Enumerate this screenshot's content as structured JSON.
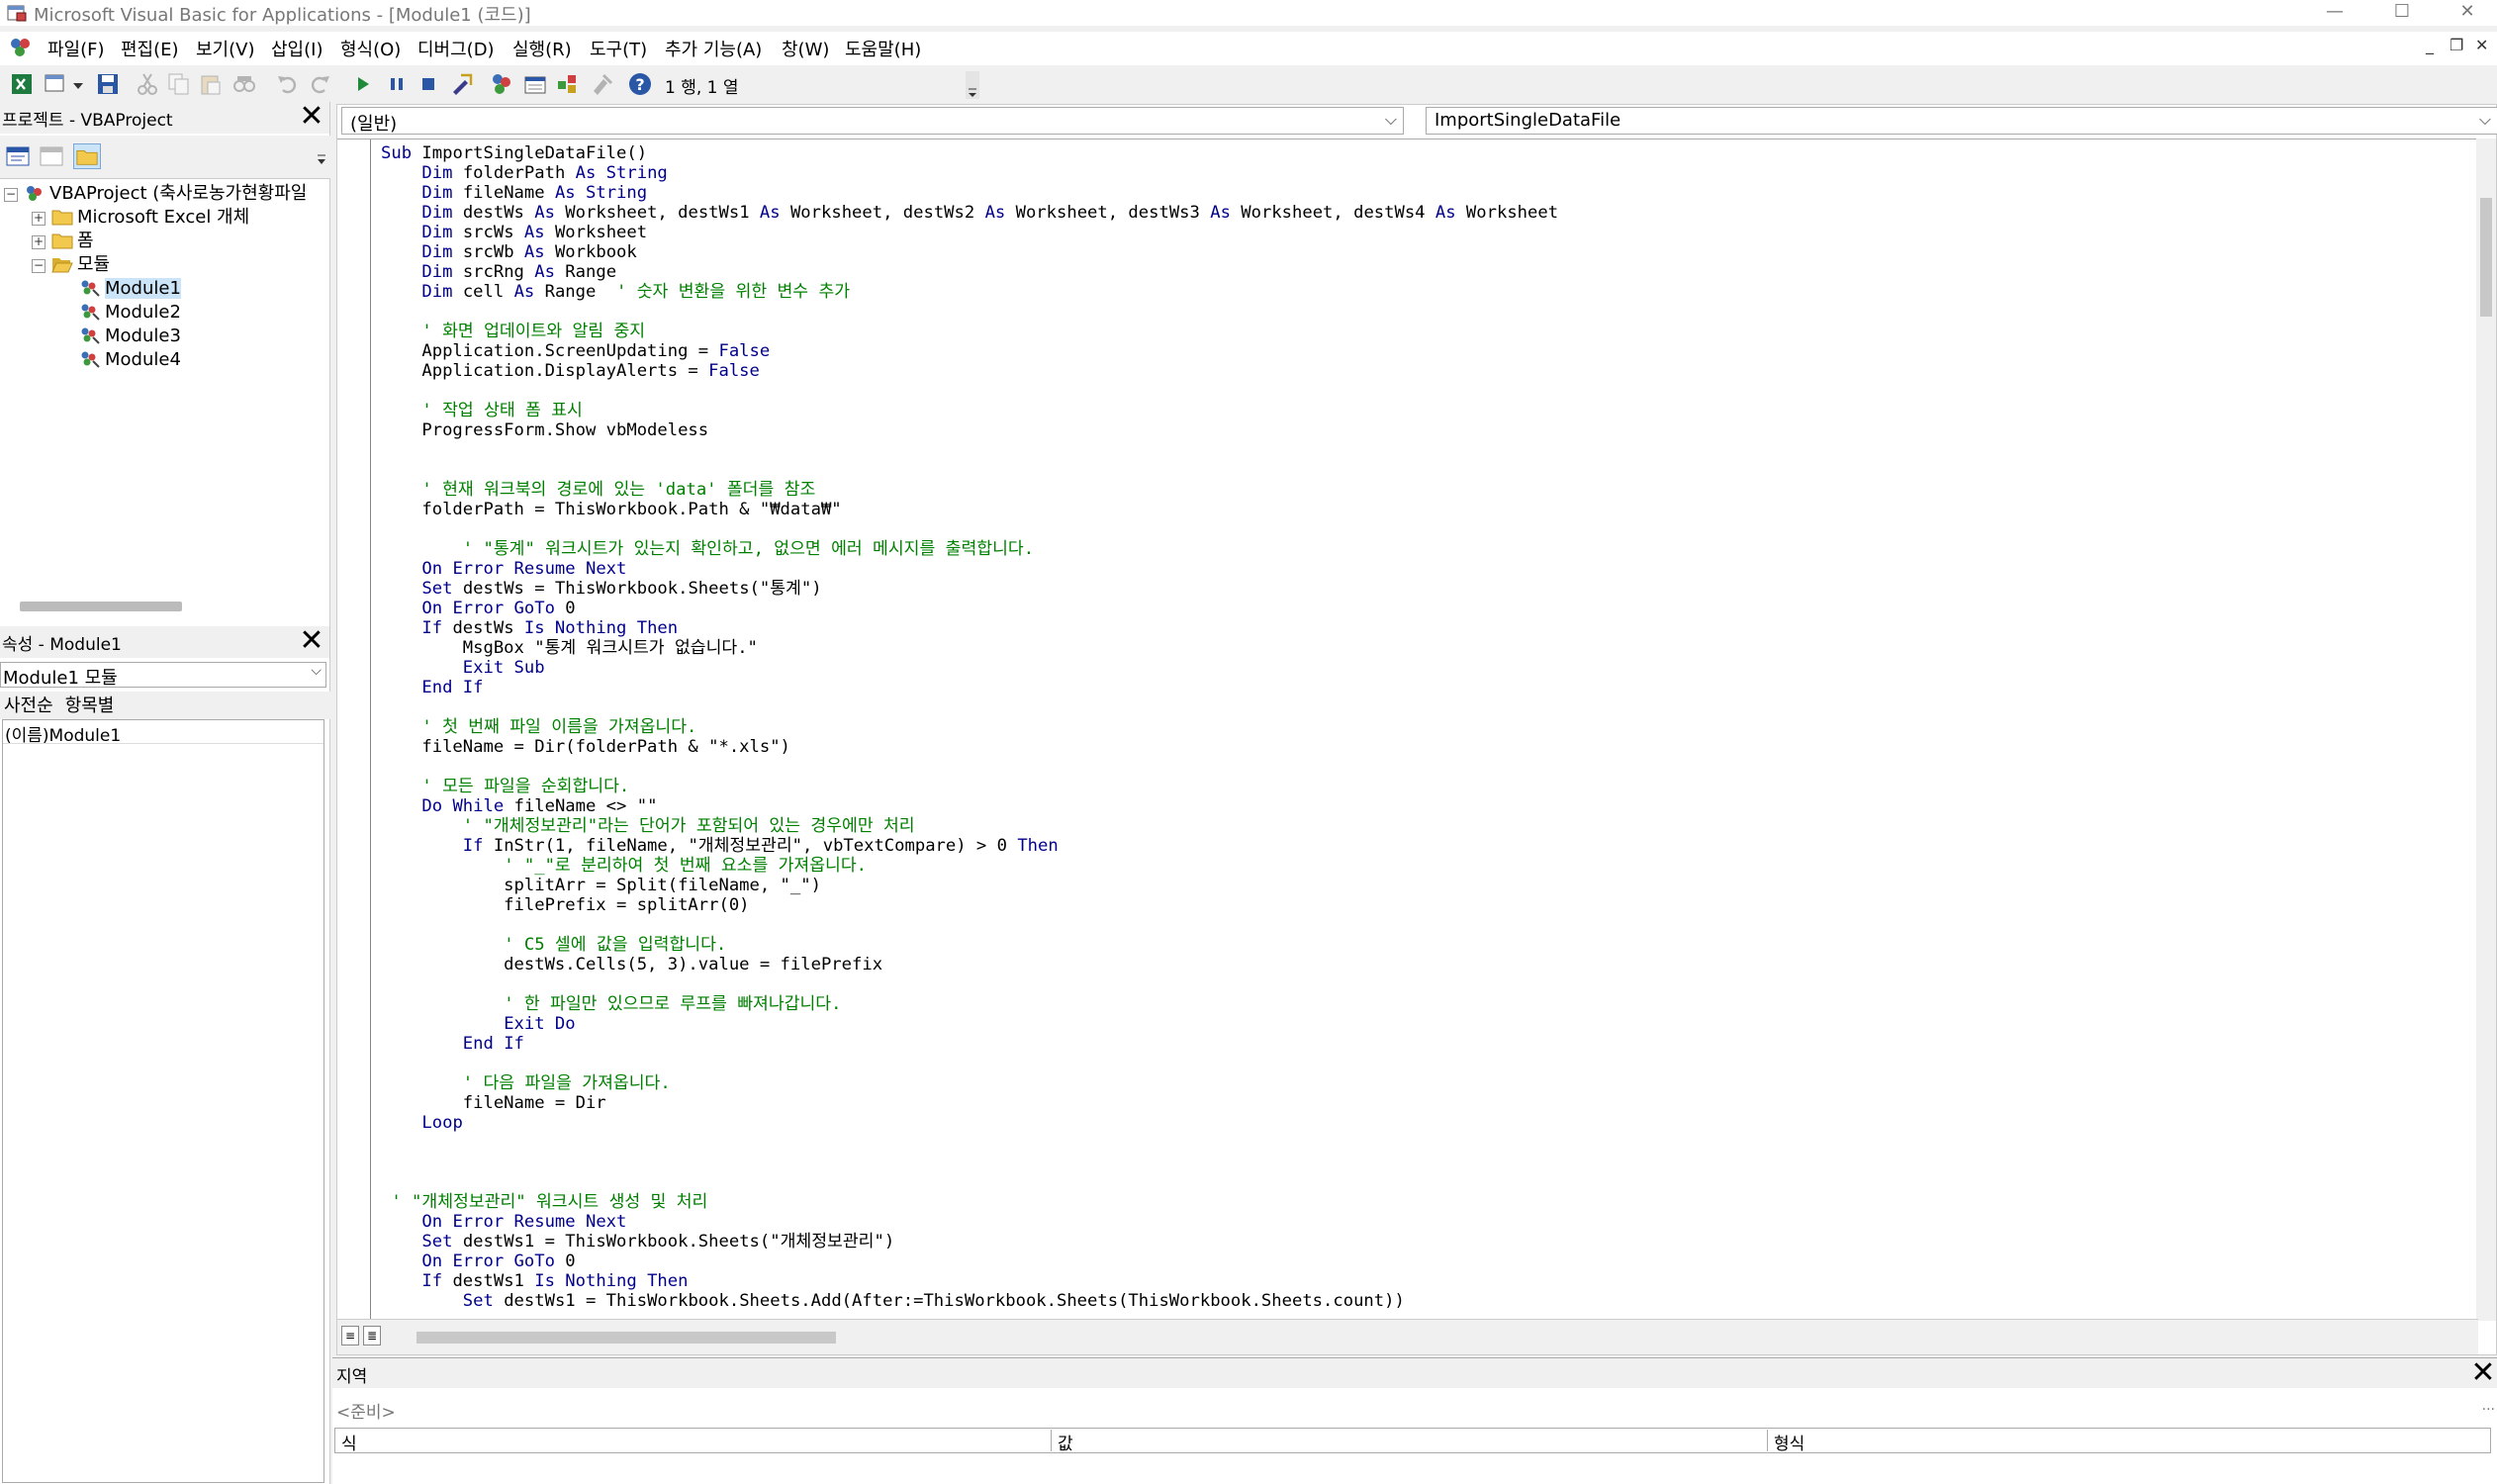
{
  "window": {
    "title": "Microsoft Visual Basic for Applications - [Module1 (코드)]",
    "minimize_glyph": "—",
    "maximize_glyph": "☐",
    "close_glyph": "✕"
  },
  "menu": {
    "items": [
      "파일(F)",
      "편집(E)",
      "보기(V)",
      "삽입(I)",
      "형식(O)",
      "디버그(D)",
      "실행(R)",
      "도구(T)",
      "추가 기능(A)",
      "창(W)",
      "도움말(H)"
    ],
    "mdi_buttons": [
      "_",
      "❐",
      "✕"
    ]
  },
  "toolbar": {
    "cursor_position": "1 행, 1 열",
    "icons": [
      "excel-view-icon",
      "insert-module-icon",
      "save-icon",
      "cut-icon",
      "copy-icon",
      "paste-icon",
      "find-icon",
      "undo-icon",
      "redo-icon",
      "run-icon",
      "break-icon",
      "reset-icon",
      "design-mode-icon",
      "project-explorer-icon",
      "properties-icon",
      "object-browser-icon",
      "toolbox-icon",
      "help-icon"
    ]
  },
  "project_explorer": {
    "title": "프로젝트 - VBAProject",
    "close_glyph": "✕",
    "tree": {
      "root": "VBAProject (축사로농가현황파일",
      "excel_objects": "Microsoft Excel 개체",
      "forms": "폼",
      "modules_folder": "모듈",
      "modules": [
        "Module1",
        "Module2",
        "Module3",
        "Module4"
      ]
    }
  },
  "properties": {
    "title": "속성 - Module1",
    "close_glyph": "✕",
    "object": "Module1 모듈",
    "tabs": [
      "사전순",
      "항목별"
    ],
    "rows": [
      {
        "name": "(이름)",
        "value": "Module1"
      }
    ]
  },
  "code_window": {
    "object_combo": "(일반)",
    "procedure_combo": "ImportSingleDataFile",
    "lines": [
      [
        [
          "k",
          "Sub "
        ],
        [
          "t",
          "ImportSingleDataFile()"
        ]
      ],
      [
        [
          "t",
          "    "
        ],
        [
          "k",
          "Dim "
        ],
        [
          "t",
          "folderPath "
        ],
        [
          "k",
          "As String"
        ]
      ],
      [
        [
          "t",
          "    "
        ],
        [
          "k",
          "Dim "
        ],
        [
          "t",
          "fileName "
        ],
        [
          "k",
          "As String"
        ]
      ],
      [
        [
          "t",
          "    "
        ],
        [
          "k",
          "Dim "
        ],
        [
          "t",
          "destWs "
        ],
        [
          "k",
          "As "
        ],
        [
          "t",
          "Worksheet, destWs1 "
        ],
        [
          "k",
          "As "
        ],
        [
          "t",
          "Worksheet, destWs2 "
        ],
        [
          "k",
          "As "
        ],
        [
          "t",
          "Worksheet, destWs3 "
        ],
        [
          "k",
          "As "
        ],
        [
          "t",
          "Worksheet, destWs4 "
        ],
        [
          "k",
          "As "
        ],
        [
          "t",
          "Worksheet"
        ]
      ],
      [
        [
          "t",
          "    "
        ],
        [
          "k",
          "Dim "
        ],
        [
          "t",
          "srcWs "
        ],
        [
          "k",
          "As "
        ],
        [
          "t",
          "Worksheet"
        ]
      ],
      [
        [
          "t",
          "    "
        ],
        [
          "k",
          "Dim "
        ],
        [
          "t",
          "srcWb "
        ],
        [
          "k",
          "As "
        ],
        [
          "t",
          "Workbook"
        ]
      ],
      [
        [
          "t",
          "    "
        ],
        [
          "k",
          "Dim "
        ],
        [
          "t",
          "srcRng "
        ],
        [
          "k",
          "As "
        ],
        [
          "t",
          "Range"
        ]
      ],
      [
        [
          "t",
          "    "
        ],
        [
          "k",
          "Dim "
        ],
        [
          "t",
          "cell "
        ],
        [
          "k",
          "As "
        ],
        [
          "t",
          "Range  "
        ],
        [
          "c",
          "' 숫자 변환을 위한 변수 추가"
        ]
      ],
      [
        [
          "t",
          ""
        ]
      ],
      [
        [
          "t",
          "    "
        ],
        [
          "c",
          "' 화면 업데이트와 알림 중지"
        ]
      ],
      [
        [
          "t",
          "    Application.ScreenUpdating = "
        ],
        [
          "k",
          "False"
        ]
      ],
      [
        [
          "t",
          "    Application.DisplayAlerts = "
        ],
        [
          "k",
          "False"
        ]
      ],
      [
        [
          "t",
          ""
        ]
      ],
      [
        [
          "t",
          "    "
        ],
        [
          "c",
          "' 작업 상태 폼 표시"
        ]
      ],
      [
        [
          "t",
          "    ProgressForm.Show vbModeless"
        ]
      ],
      [
        [
          "t",
          ""
        ]
      ],
      [
        [
          "t",
          ""
        ]
      ],
      [
        [
          "t",
          "    "
        ],
        [
          "c",
          "' 현재 워크북의 경로에 있는 'data' 폴더를 참조"
        ]
      ],
      [
        [
          "t",
          "    folderPath = ThisWorkbook.Path & \"₩data₩\""
        ]
      ],
      [
        [
          "t",
          ""
        ]
      ],
      [
        [
          "t",
          "        "
        ],
        [
          "c",
          "' \"통계\" 워크시트가 있는지 확인하고, 없으면 에러 메시지를 출력합니다."
        ]
      ],
      [
        [
          "t",
          "    "
        ],
        [
          "k",
          "On Error Resume Next"
        ]
      ],
      [
        [
          "t",
          "    "
        ],
        [
          "k",
          "Set "
        ],
        [
          "t",
          "destWs = ThisWorkbook.Sheets(\"통계\")"
        ]
      ],
      [
        [
          "t",
          "    "
        ],
        [
          "k",
          "On Error GoTo "
        ],
        [
          "t",
          "0"
        ]
      ],
      [
        [
          "t",
          "    "
        ],
        [
          "k",
          "If "
        ],
        [
          "t",
          "destWs "
        ],
        [
          "k",
          "Is Nothing Then"
        ]
      ],
      [
        [
          "t",
          "        MsgBox \"통계 워크시트가 없습니다.\""
        ]
      ],
      [
        [
          "t",
          "        "
        ],
        [
          "k",
          "Exit Sub"
        ]
      ],
      [
        [
          "t",
          "    "
        ],
        [
          "k",
          "End If"
        ]
      ],
      [
        [
          "t",
          ""
        ]
      ],
      [
        [
          "t",
          "    "
        ],
        [
          "c",
          "' 첫 번째 파일 이름을 가져옵니다."
        ]
      ],
      [
        [
          "t",
          "    fileName = Dir(folderPath & \"*.xls\")"
        ]
      ],
      [
        [
          "t",
          ""
        ]
      ],
      [
        [
          "t",
          "    "
        ],
        [
          "c",
          "' 모든 파일을 순회합니다."
        ]
      ],
      [
        [
          "t",
          "    "
        ],
        [
          "k",
          "Do While "
        ],
        [
          "t",
          "fileName <> \"\""
        ]
      ],
      [
        [
          "t",
          "        "
        ],
        [
          "c",
          "' \"개체정보관리\"라는 단어가 포함되어 있는 경우에만 처리"
        ]
      ],
      [
        [
          "t",
          "        "
        ],
        [
          "k",
          "If "
        ],
        [
          "t",
          "InStr(1, fileName, \"개체정보관리\", vbTextCompare) > 0 "
        ],
        [
          "k",
          "Then"
        ]
      ],
      [
        [
          "t",
          "            "
        ],
        [
          "c",
          "' \"_\"로 분리하여 첫 번째 요소를 가져옵니다."
        ]
      ],
      [
        [
          "t",
          "            splitArr = Split(fileName, \"_\")"
        ]
      ],
      [
        [
          "t",
          "            filePrefix = splitArr(0)"
        ]
      ],
      [
        [
          "t",
          ""
        ]
      ],
      [
        [
          "t",
          "            "
        ],
        [
          "c",
          "' C5 셀에 값을 입력합니다."
        ]
      ],
      [
        [
          "t",
          "            destWs.Cells(5, 3).value = filePrefix"
        ]
      ],
      [
        [
          "t",
          ""
        ]
      ],
      [
        [
          "t",
          "            "
        ],
        [
          "c",
          "' 한 파일만 있으므로 루프를 빠져나갑니다."
        ]
      ],
      [
        [
          "t",
          "            "
        ],
        [
          "k",
          "Exit Do"
        ]
      ],
      [
        [
          "t",
          "        "
        ],
        [
          "k",
          "End If"
        ]
      ],
      [
        [
          "t",
          ""
        ]
      ],
      [
        [
          "t",
          "        "
        ],
        [
          "c",
          "' 다음 파일을 가져옵니다."
        ]
      ],
      [
        [
          "t",
          "        fileName = Dir"
        ]
      ],
      [
        [
          "t",
          "    "
        ],
        [
          "k",
          "Loop"
        ]
      ],
      [
        [
          "t",
          ""
        ]
      ],
      [
        [
          "t",
          ""
        ]
      ],
      [
        [
          "t",
          ""
        ]
      ],
      [
        [
          "t",
          " "
        ],
        [
          "c",
          "' \"개체정보관리\" 워크시트 생성 및 처리"
        ]
      ],
      [
        [
          "t",
          "    "
        ],
        [
          "k",
          "On Error Resume Next"
        ]
      ],
      [
        [
          "t",
          "    "
        ],
        [
          "k",
          "Set "
        ],
        [
          "t",
          "destWs1 = ThisWorkbook.Sheets(\"개체정보관리\")"
        ]
      ],
      [
        [
          "t",
          "    "
        ],
        [
          "k",
          "On Error GoTo "
        ],
        [
          "t",
          "0"
        ]
      ],
      [
        [
          "t",
          "    "
        ],
        [
          "k",
          "If "
        ],
        [
          "t",
          "destWs1 "
        ],
        [
          "k",
          "Is Nothing Then"
        ]
      ],
      [
        [
          "t",
          "        "
        ],
        [
          "k",
          "Set "
        ],
        [
          "t",
          "destWs1 = ThisWorkbook.Sheets.Add(After:=ThisWorkbook.Sheets(ThisWorkbook.Sheets.count))"
        ]
      ]
    ]
  },
  "locals": {
    "title": "지역",
    "close_glyph": "✕",
    "context": "<준비>",
    "context_button": "...",
    "columns": [
      "식",
      "값",
      "형식"
    ]
  },
  "colors": {
    "keyword": "#00008b",
    "comment": "#008000",
    "selection": "#cce4f7"
  }
}
